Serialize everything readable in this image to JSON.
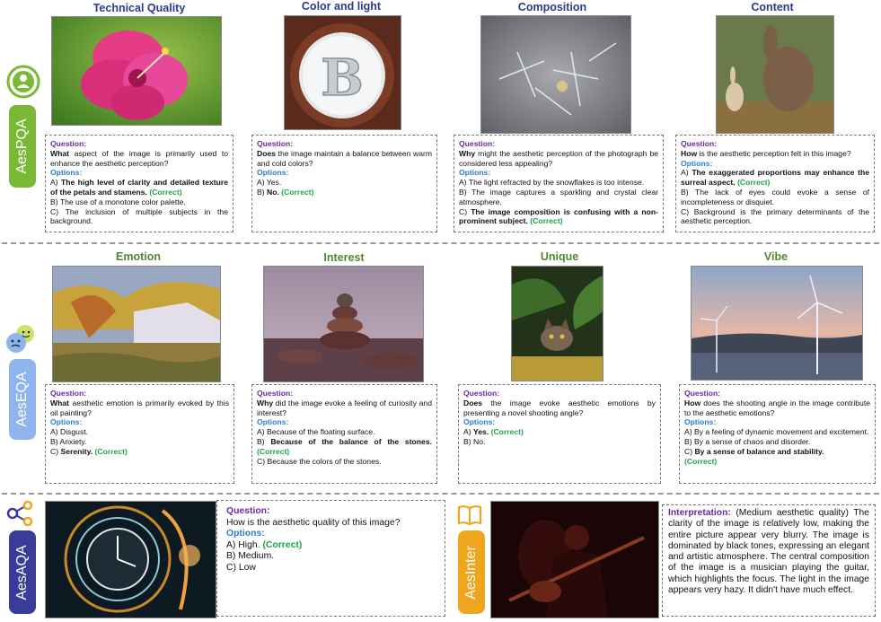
{
  "sections": {
    "aespqa": "AesPQA",
    "aeseqa": "AesEQA",
    "aesaqa": "AesAQA",
    "aesinter": "AesInter"
  },
  "labels": {
    "question": "Question:",
    "options": "Options:",
    "correct": "(Correct)",
    "interpretation": "Interpretation:"
  },
  "row1": [
    {
      "title": "Technical Quality",
      "q_bold": "What",
      "q_rest": " aspect of the image is primarily used to enhance the aesthetic perception?",
      "a": "A) ",
      "a_text": "The high level of clarity and detailed texture of the petals and stamens.",
      "b": "B) The use of a monotone color palette.",
      "c": "C) The inclusion of multiple subjects in the background."
    },
    {
      "title": "Color and light",
      "q_bold": "Does",
      "q_rest": " the image maintain a balance between warm and cold colors?",
      "a": "A) Yes.",
      "b": "B) ",
      "b_text": "No."
    },
    {
      "title": "Composition",
      "q_bold": "Why",
      "q_rest": " might the aesthetic perception of the photograph be considered less appealing?",
      "a": "A) The light refracted by the snowflakes is too intense.",
      "b": "B) The image captures a sparkling and crystal clear atmosphere.",
      "c": "C) ",
      "c_text": "The image composition is confusing with a non-prominent subject."
    },
    {
      "title": "Content",
      "q_bold": "How",
      "q_rest": " is the aesthetic perception felt in this image?",
      "a": "A) ",
      "a_text": "The exaggerated proportions may enhance the surreal aspect.",
      "b": "B) The lack of eyes could evoke a sense of incompleteness or disquiet.",
      "c": "C) Background is the primary determinants of the aesthetic perception."
    }
  ],
  "row2": [
    {
      "title": "Emotion",
      "q_bold": "What",
      "q_rest": " aesthetic emotion is primarily evoked by this oil painting?",
      "a": "A) Disgust.",
      "b": "B) Anxiety.",
      "c": "C) ",
      "c_text": "Serenity."
    },
    {
      "title": "Interest",
      "q_bold": "Why",
      "q_rest": " did the image evoke a feeling of curiosity and interest?",
      "a": "A) Because of the floating surface.",
      "b": "B) ",
      "b_text": "Because of the balance of the stones.",
      "c": "C) Because the colors of the stones."
    },
    {
      "title": "Unique",
      "q_bold": "Does",
      "q_rest": " the image evoke aesthetic emotions by presenting a novel shooting angle?",
      "a": "A) ",
      "a_text": "Yes.",
      "b": "B) No."
    },
    {
      "title": "Vibe",
      "q_bold": "How",
      "q_rest": " does the shooting angle in the image contribute to the aesthetic emotions?",
      "a": "A) By a feeling of dynamic movement and excitement.",
      "b": "B) By a sense of chaos and disorder.",
      "c": "C) ",
      "c_text": "By a sense of balance and stability."
    }
  ],
  "aqa": {
    "question": "How is the aesthetic quality of this image?",
    "a": "A) High.",
    "b": "B) Medium.",
    "c": "C) Low"
  },
  "inter": {
    "level": "(Medium aesthetic quality)",
    "text": "The clarity of the image is relatively low, making the entire picture appear very blurry. The image is dominated by black tones, expressing an elegant and artistic atmosphere. The central composition of the image is a musician playing the guitar, which highlights the focus. The light in the image appears very hazy. It didn't have much effect."
  },
  "colors": {
    "pqa": "#7ab836",
    "eqa": "#8fb4ee",
    "aqa": "#3a3c9a",
    "inter": "#f0a51e",
    "correct": "#1ea34a"
  }
}
